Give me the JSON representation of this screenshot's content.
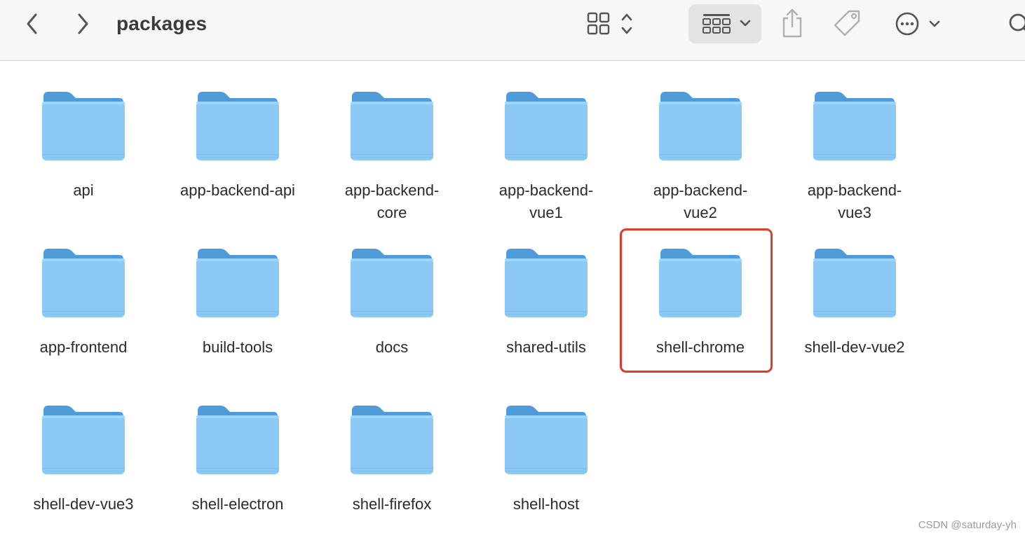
{
  "window": {
    "title": "packages"
  },
  "toolbar": {
    "back_icon": "chevron-left-icon",
    "forward_icon": "chevron-right-icon",
    "view_icon": "grid-view-icon",
    "group_icon": "group-by-icon",
    "share_icon": "share-icon",
    "tag_icon": "tag-icon",
    "more_icon": "ellipsis-circle-icon",
    "search_icon": "search-icon"
  },
  "colors": {
    "highlight": "#e03a2a",
    "folder_front": "#8ccaf5",
    "folder_back": "#4f9bd9"
  },
  "folders": [
    "api",
    "app-backend-api",
    "app-backend-core",
    "app-backend-vue1",
    "app-backend-vue2",
    "app-backend-vue3",
    "app-frontend",
    "build-tools",
    "docs",
    "shared-utils",
    "shell-chrome",
    "shell-dev-vue2",
    "shell-dev-vue3",
    "shell-electron",
    "shell-firefox",
    "shell-host"
  ],
  "folder_labels_display": [
    "api",
    "app-backend-api",
    "app-backend-\ncore",
    "app-backend-\nvue1",
    "app-backend-\nvue2",
    "app-backend-\nvue3",
    "app-frontend",
    "build-tools",
    "docs",
    "shared-utils",
    "shell-chrome",
    "shell-dev-vue2",
    "shell-dev-vue3",
    "shell-electron",
    "shell-firefox",
    "shell-host"
  ],
  "highlighted_folder": "shell-chrome",
  "watermark": "CSDN @saturday-yh"
}
